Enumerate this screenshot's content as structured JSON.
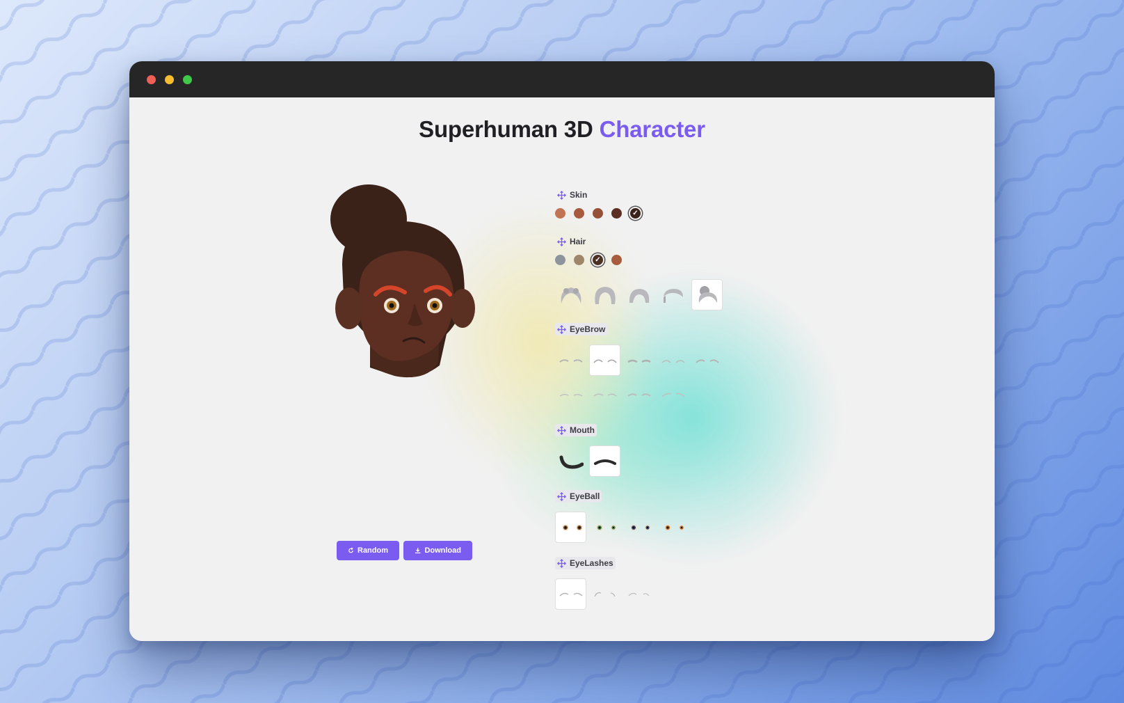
{
  "title": {
    "main": "Superhuman 3D",
    "accent": "Character"
  },
  "window_controls": [
    "close",
    "minimize",
    "maximize"
  ],
  "buttons": {
    "random": "Random",
    "download": "Download"
  },
  "sections": {
    "skin": {
      "label": "Skin",
      "colors": [
        "#c07454",
        "#a85a3e",
        "#95503a",
        "#5b2f24",
        "#3b2219"
      ],
      "selected": 4
    },
    "hair": {
      "label": "Hair",
      "colors": [
        "#8e949b",
        "#9f8669",
        "#4a3124",
        "#a65c3d"
      ],
      "selected": 2,
      "styles": [
        "hair-curly",
        "hair-afro",
        "hair-wave",
        "hair-short",
        "hair-bun"
      ],
      "selected_style": 4
    },
    "eyebrow": {
      "label": "EyeBrow",
      "styles_row1": [
        "brow-1",
        "brow-2",
        "brow-3",
        "brow-4",
        "brow-5"
      ],
      "styles_row2": [
        "brow-6",
        "brow-7",
        "brow-8",
        "brow-9"
      ],
      "selected": 1
    },
    "mouth": {
      "label": "Mouth",
      "styles": [
        "mouth-smirk",
        "mouth-flat"
      ],
      "selected": 1
    },
    "eyeball": {
      "label": "EyeBall",
      "styles": [
        "eye-brown",
        "eye-green",
        "eye-blue",
        "eye-amber"
      ],
      "selected": 0
    },
    "eyelashes": {
      "label": "EyeLashes",
      "styles": [
        "lash-1",
        "lash-2",
        "lash-3"
      ],
      "selected": 0
    }
  },
  "accent_color": "#7b5cf0"
}
